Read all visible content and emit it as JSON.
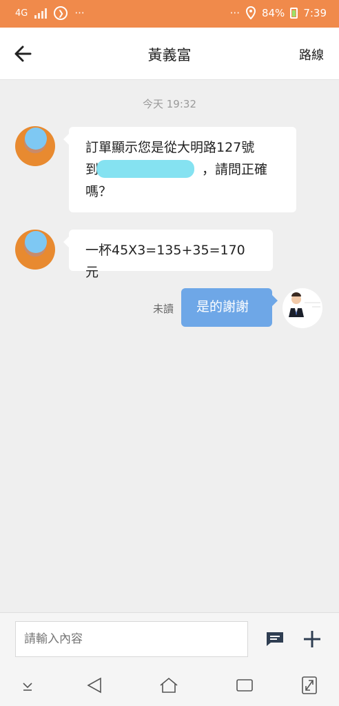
{
  "status": {
    "network": "4G",
    "battery": "84%",
    "time": "7:39",
    "more_left": "···",
    "more_right": "···"
  },
  "header": {
    "title": "黃義富",
    "route_label": "路線"
  },
  "chat": {
    "timestamp": "今天 19:32",
    "messages": [
      {
        "line1": "訂單顯示您是從大明路127號",
        "line2": "到",
        "line2_tail": "，請問正確",
        "line3": "嗎？"
      },
      {
        "text": "一杯45X3=135+35=170元"
      },
      {
        "text": "是的謝謝",
        "status": "未讀"
      }
    ]
  },
  "input": {
    "placeholder": "請輸入內容"
  }
}
